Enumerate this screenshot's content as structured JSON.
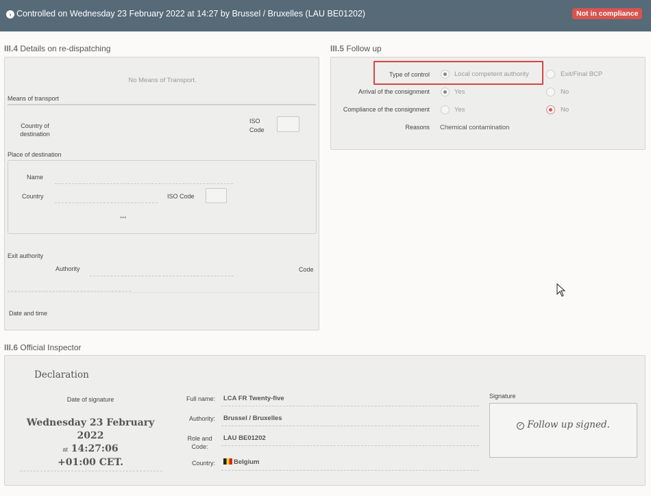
{
  "header": {
    "title": "Controlled on Wednesday 23 February 2022 at 14:27 by Brussel / Bruxelles (LAU BE01202)",
    "status_badge": "Not in compliance",
    "badge_color": "#d9534f",
    "bar_color": "#566a78"
  },
  "s4": {
    "num": "III.4",
    "title": "Details on re-dispatching",
    "no_transport": "No Means of Transport.",
    "means_label": "Means of transport",
    "country_dest_label": "Country of destination",
    "iso_code_label": "ISO Code",
    "place_dest_label": "Place of destination",
    "name_label": "Name",
    "country_label": "Country",
    "iso_code_label2": "ISO Code",
    "more": "•••",
    "exit_authority_label": "Exit authority",
    "authority_label": "Authority",
    "code_label": "Code",
    "date_time_label": "Date and time"
  },
  "s5": {
    "num": "III.5",
    "title": "Follow up",
    "type_label": "Type of control",
    "type_opt1": "Local competent authority",
    "type_opt2": "Exit/Final BCP",
    "arrival_label": "Arrival of the consignment",
    "arrival_yes": "Yes",
    "arrival_no": "No",
    "compliance_label": "Compliance of the consignment",
    "compliance_yes": "Yes",
    "compliance_no": "No",
    "reasons_label": "Reasons",
    "reasons_value": "Chemical contamination"
  },
  "s6": {
    "num": "III.6",
    "title": "Official Inspector",
    "declaration": "Declaration",
    "date_sig_label": "Date of signature",
    "date_line1": "Wednesday 23 February",
    "date_line2": "2022",
    "at": "at",
    "time": "14:27:06",
    "tz": "+01:00 CET.",
    "fullname_label": "Full name:",
    "fullname": "LCA FR Twenty-five",
    "authority_label": "Authority:",
    "authority": "Brussel / Bruxelles",
    "role_label": "Role and Code:",
    "role": "LAU BE01202",
    "country_label": "Country:",
    "country": "Belgium",
    "signature_label": "Signature",
    "signed_text": "Follow up signed."
  }
}
